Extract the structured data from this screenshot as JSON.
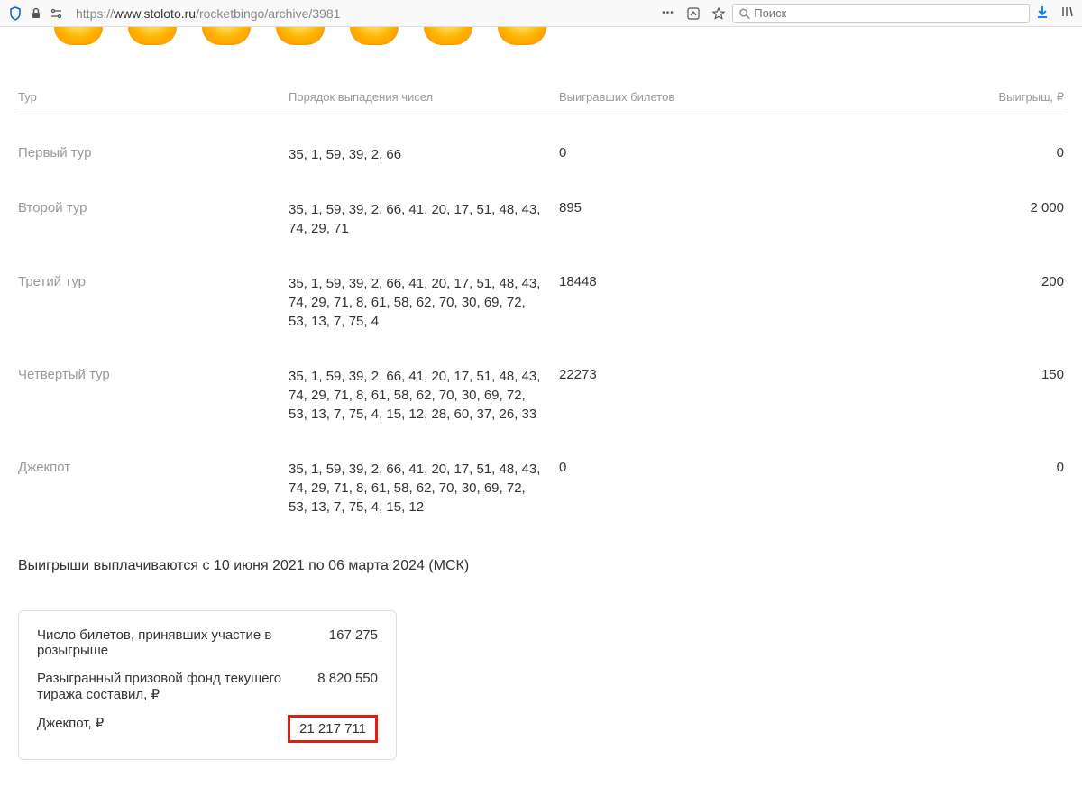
{
  "browser": {
    "url_protocol": "https://",
    "url_domain": "www.stoloto.ru",
    "url_path": "/rocketbingo/archive/3981",
    "search_placeholder": "Поиск"
  },
  "table": {
    "headers": {
      "tour": "Тур",
      "order": "Порядок выпадения чисел",
      "tickets": "Выигравших билетов",
      "prize": "Выигрыш, ₽"
    },
    "rows": [
      {
        "tour": "Первый тур",
        "numbers": "35, 1, 59, 39, 2, 66",
        "tickets": "0",
        "prize": "0"
      },
      {
        "tour": "Второй тур",
        "numbers": "35, 1, 59, 39, 2, 66, 41, 20, 17, 51, 48, 43, 74, 29, 71",
        "tickets": "895",
        "prize": "2 000"
      },
      {
        "tour": "Третий тур",
        "numbers": "35, 1, 59, 39, 2, 66, 41, 20, 17, 51, 48, 43, 74, 29, 71, 8, 61, 58, 62, 70, 30, 69, 72, 53, 13, 7, 75, 4",
        "tickets": "18448",
        "prize": "200"
      },
      {
        "tour": "Четвертый тур",
        "numbers": "35, 1, 59, 39, 2, 66, 41, 20, 17, 51, 48, 43, 74, 29, 71, 8, 61, 58, 62, 70, 30, 69, 72, 53, 13, 7, 75, 4, 15, 12, 28, 60, 37, 26, 33",
        "tickets": "22273",
        "prize": "150"
      },
      {
        "tour": "Джекпот",
        "numbers": "35, 1, 59, 39, 2, 66, 41, 20, 17, 51, 48, 43, 74, 29, 71, 8, 61, 58, 62, 70, 30, 69, 72, 53, 13, 7, 75, 4, 15, 12",
        "tickets": "0",
        "prize": "0"
      }
    ]
  },
  "payout_info": "Выигрыши выплачиваются с 10 июня 2021 по 06 марта 2024 (МСК)",
  "summary": {
    "rows": [
      {
        "label": "Число билетов, принявших участие в розыгрыше",
        "value": "167 275"
      },
      {
        "label": "Разыгранный призовой фонд текущего тиража составил, ₽",
        "value": "8 820 550"
      },
      {
        "label": "Джекпот, ₽",
        "value": "21 217 711",
        "highlight": true
      }
    ]
  }
}
